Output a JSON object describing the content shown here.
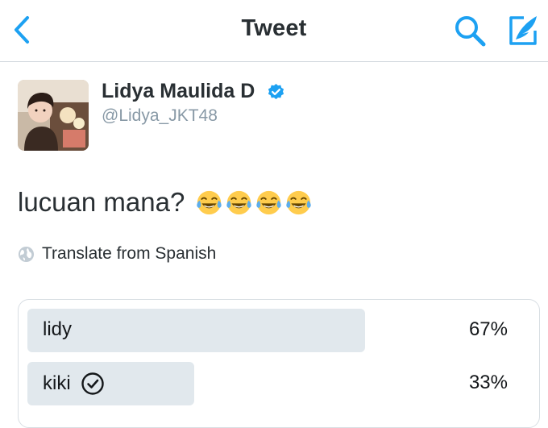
{
  "header": {
    "title": "Tweet",
    "accent_color": "#1da1f2"
  },
  "tweet": {
    "author": {
      "display_name": "Lidya Maulida D",
      "handle": "@Lidya_JKT48",
      "verified": true
    },
    "text": "lucuan mana?",
    "emoji": [
      "face-with-tears-of-joy",
      "face-with-tears-of-joy",
      "face-with-tears-of-joy",
      "face-with-tears-of-joy"
    ],
    "translate_label": "Translate from Spanish"
  },
  "poll": {
    "options": [
      {
        "label": "lidy",
        "percent_label": "67%",
        "fraction": 0.67,
        "selected": false
      },
      {
        "label": "kiki",
        "percent_label": "33%",
        "fraction": 0.33,
        "selected": true
      }
    ],
    "bar_color": "#e1e8ed"
  }
}
